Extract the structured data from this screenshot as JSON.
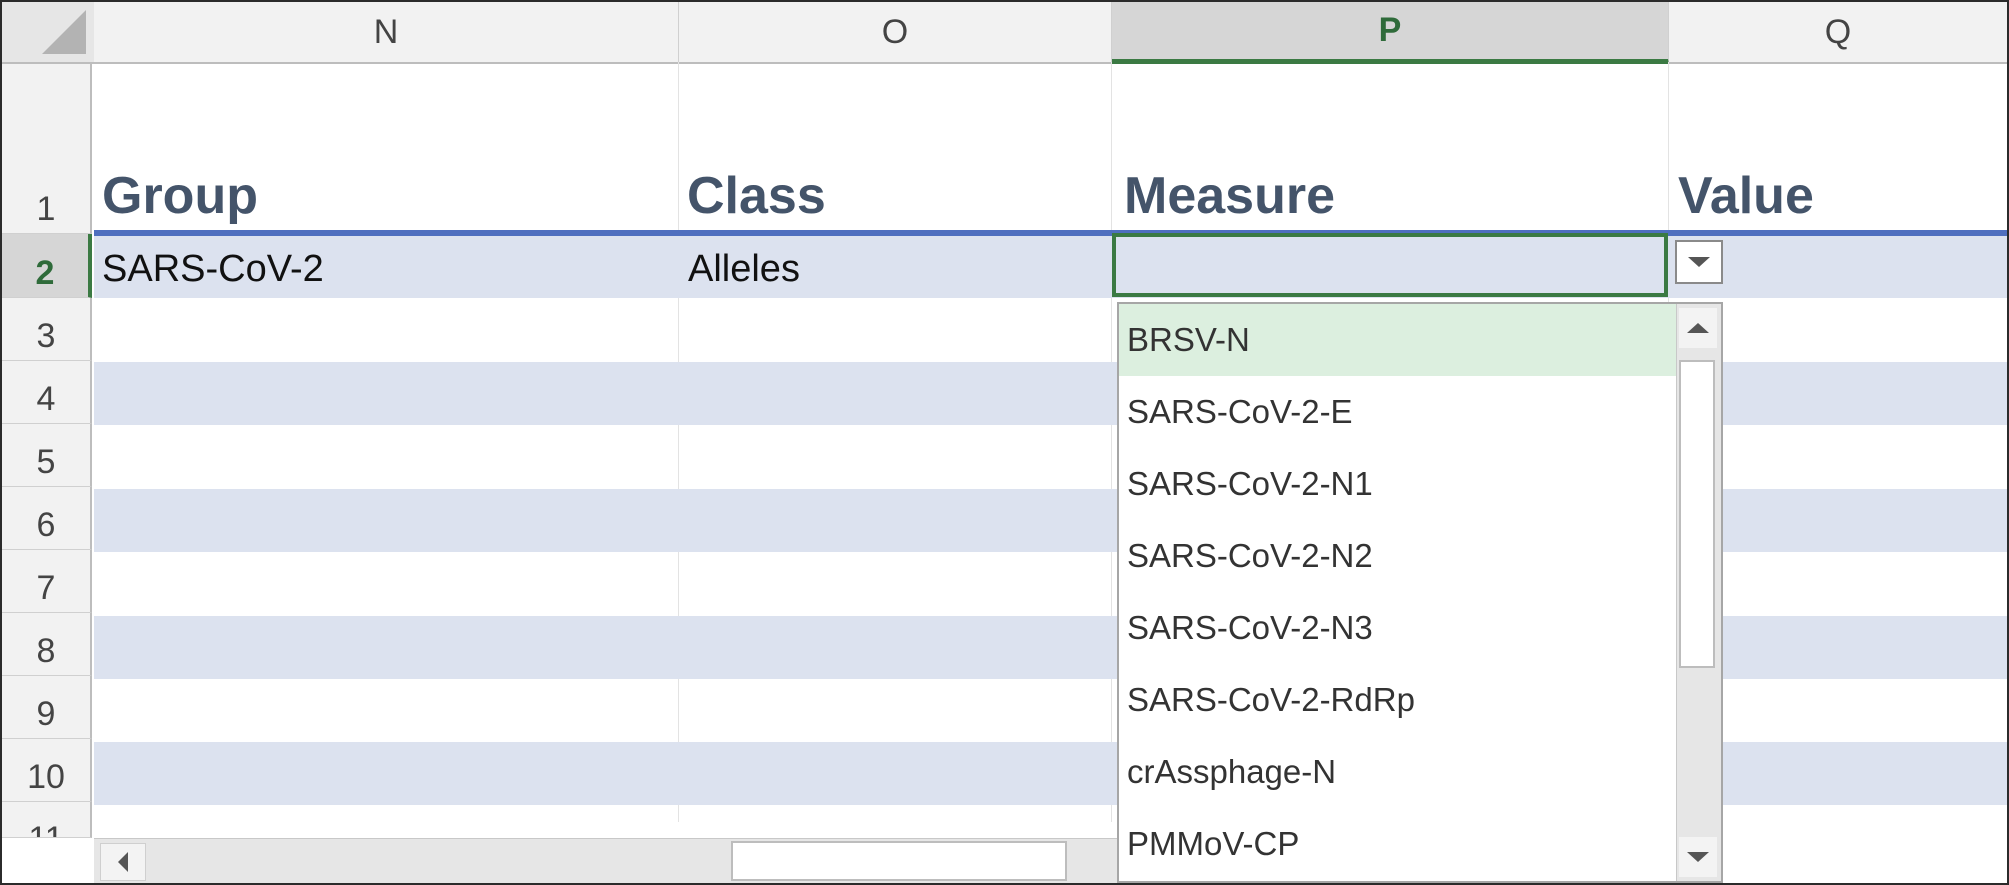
{
  "columns": [
    "N",
    "O",
    "P",
    "Q"
  ],
  "selected_column": "P",
  "rows": [
    "1",
    "2",
    "3",
    "4",
    "5",
    "6",
    "7",
    "8",
    "9",
    "10",
    "11"
  ],
  "selected_row": "2",
  "headers": {
    "group": "Group",
    "class": "Class",
    "measure": "Measure",
    "value": "Value"
  },
  "data_row_2": {
    "group": "SARS-CoV-2",
    "class": "Alleles",
    "measure": "",
    "value": ""
  },
  "dropdown": {
    "highlighted_index": 0,
    "options": [
      "BRSV-N",
      "SARS-CoV-2-E",
      "SARS-CoV-2-N1",
      "SARS-CoV-2-N2",
      "SARS-CoV-2-N3",
      "SARS-CoV-2-RdRp",
      "crAssphage-N",
      "PMMoV-CP"
    ]
  },
  "colors": {
    "band": "#dce2ef",
    "selection_green": "#3b7a43",
    "header_text": "#44546a",
    "highlight": "#dcefdf",
    "table_rule": "#4f6fbf"
  },
  "icons": {
    "dropdown_button": "chevron-down-icon",
    "scroll_up": "chevron-up-icon",
    "scroll_down": "chevron-down-icon",
    "scroll_left": "chevron-left-icon",
    "select_all": "select-all-triangle-icon"
  }
}
